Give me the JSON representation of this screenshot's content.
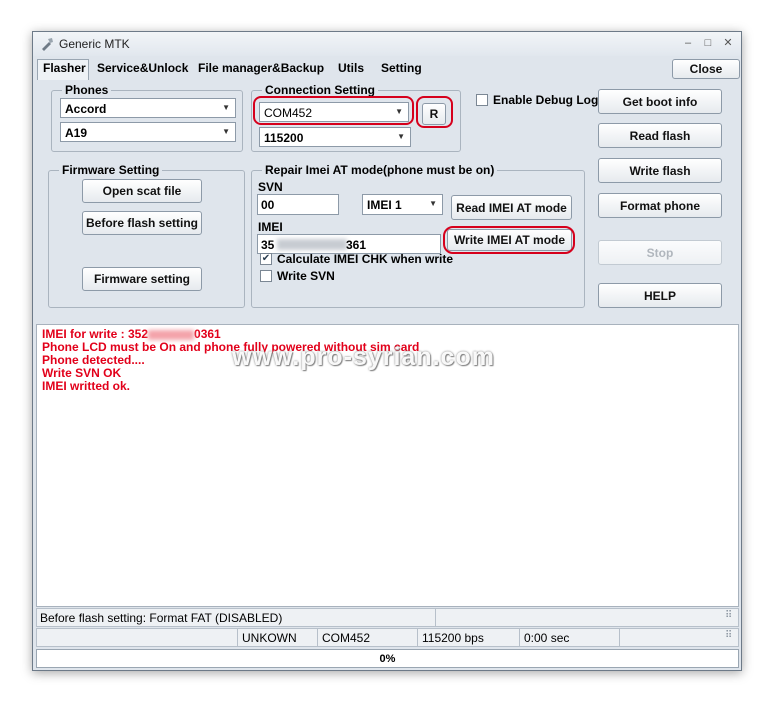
{
  "window": {
    "title": "Generic MTK"
  },
  "tabs": [
    {
      "label": "Flasher"
    },
    {
      "label": "Service&Unlock"
    },
    {
      "label": "File manager&Backup"
    },
    {
      "label": "Utils"
    },
    {
      "label": "Setting"
    }
  ],
  "close_label": "Close",
  "phones": {
    "title": "Phones",
    "brand": "Accord",
    "model": "A19"
  },
  "connection": {
    "title": "Connection Setting",
    "port": "COM452",
    "baud": "115200",
    "refresh_label": "R"
  },
  "debug_log": {
    "label": "Enable Debug Log",
    "checked": false
  },
  "firmware": {
    "title": "Firmware Setting",
    "open_scat": "Open scat file",
    "before_flash": "Before flash setting",
    "firmware_setting": "Firmware setting"
  },
  "repair": {
    "title": "Repair Imei AT mode(phone must be on)",
    "svn_label": "SVN",
    "svn_value": "00",
    "imei_slot": "IMEI 1",
    "read_button": "Read IMEI AT mode",
    "imei_label": "IMEI",
    "imei_prefix": "35",
    "imei_suffix": "361",
    "write_button": "Write IMEI AT mode",
    "calc_chk_label": "Calculate IMEI CHK when write",
    "calc_chk_checked": true,
    "write_svn_label": "Write SVN",
    "write_svn_checked": false
  },
  "right_buttons": {
    "get_boot_info": "Get boot info",
    "read_flash": "Read flash",
    "write_flash": "Write flash",
    "format_phone": "Format phone",
    "stop": "Stop",
    "help": "HELP"
  },
  "log": {
    "line1_prefix": "IMEI for write : 352",
    "line1_suffix": "0361",
    "line2_a": "Phone LCD must be O",
    "line2_b": "n and phone fully powered without sim card",
    "line3": "Phone detected....",
    "line4": "Write SVN OK",
    "line5": "IMEI writted ok."
  },
  "watermark": "www.pro-syrian.com",
  "status": {
    "message": "Before flash setting: Format FAT (DISABLED)",
    "connection": "UNKOWN",
    "port": "COM452",
    "baud": "115200 bps",
    "time": "0:00 sec",
    "progress": "0%"
  },
  "colors": {
    "highlight_ring": "#d6001c",
    "log_text": "#e2001a"
  }
}
